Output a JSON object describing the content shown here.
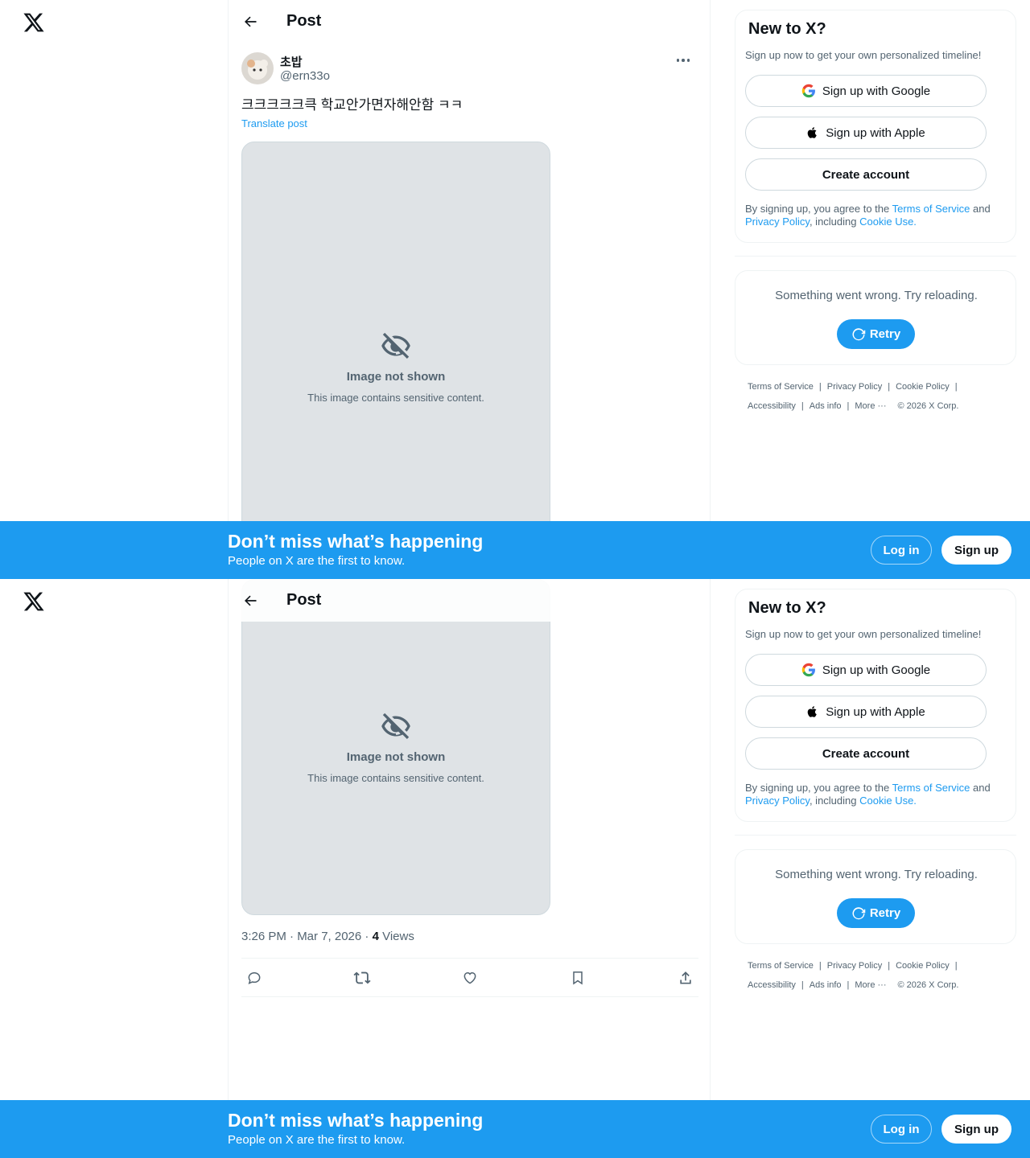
{
  "header": {
    "title": "Post"
  },
  "post": {
    "display_name": "초밥",
    "handle": "@ern33o",
    "text": "크크크크크큭 학교안가면자해안함 ㅋㅋ",
    "translate_label": "Translate post",
    "media_notice": "Image not shown",
    "media_sub": "This image contains sensitive content.",
    "time": "3:26 PM · Mar 7, 2026 · ",
    "views_count": "4",
    "views_label": " Views"
  },
  "signup_card": {
    "title": "New to X?",
    "subtitle": "Sign up now to get your own personalized timeline!",
    "google_label": "Sign up with Google",
    "apple_label": "Sign up with Apple",
    "create_label": "Create account",
    "legal_pre": "By signing up, you agree to the ",
    "terms": "Terms of Service",
    "and": " and ",
    "privacy": "Privacy Policy",
    "including": ", including ",
    "cookie": "Cookie Use."
  },
  "error_card": {
    "message": "Something went wrong. Try reloading.",
    "retry_label": "Retry"
  },
  "footer": {
    "terms": "Terms of Service",
    "privacy": "Privacy Policy",
    "cookie": "Cookie Policy",
    "accessibility": "Accessibility",
    "ads": "Ads info",
    "more": "More ···",
    "copyright": "© 2026 X Corp."
  },
  "banner": {
    "title": "Don’t miss what’s happening",
    "subtitle": "People on X are the first to know.",
    "login_label": "Log in",
    "signup_label": "Sign up"
  },
  "colors": {
    "accent": "#1d9bf0",
    "text": "#0f1419",
    "secondary": "#536471",
    "border": "#eff3f4"
  }
}
